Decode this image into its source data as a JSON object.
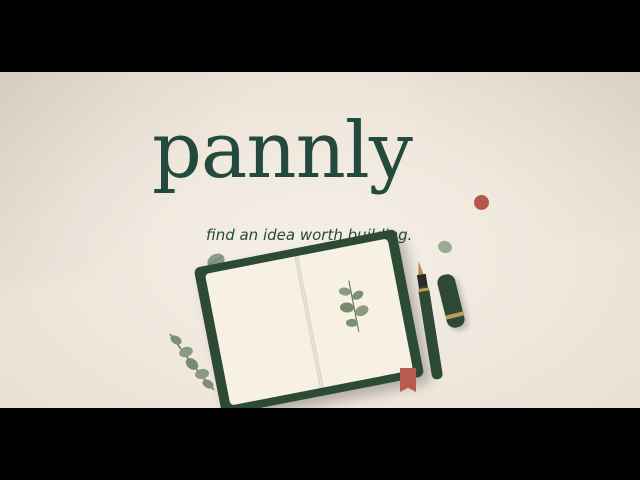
{
  "brand": {
    "wordmark": "pannly",
    "tagline": "find an idea worth building.",
    "dot_color": "#b4584e",
    "text_color": "#234a3c"
  },
  "scene": {
    "background_color": "#efe7dc",
    "objects": [
      "notebook",
      "fountain-pen",
      "pen-cap",
      "eucalyptus-sprig",
      "leaf",
      "ribbon-clip"
    ]
  }
}
